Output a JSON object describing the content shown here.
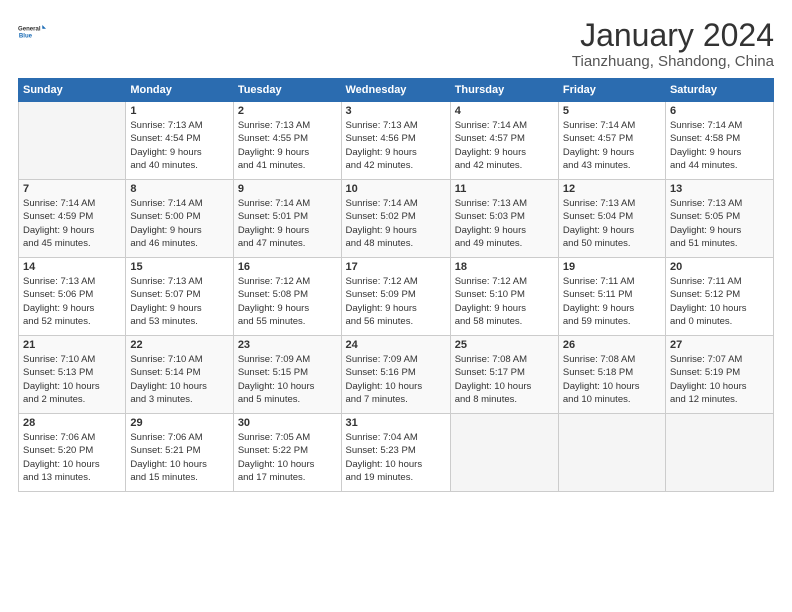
{
  "logo": {
    "line1": "General",
    "line2": "Blue"
  },
  "title": {
    "month_year": "January 2024",
    "location": "Tianzhuang, Shandong, China"
  },
  "weekdays": [
    "Sunday",
    "Monday",
    "Tuesday",
    "Wednesday",
    "Thursday",
    "Friday",
    "Saturday"
  ],
  "weeks": [
    [
      {
        "day": "",
        "info": ""
      },
      {
        "day": "1",
        "info": "Sunrise: 7:13 AM\nSunset: 4:54 PM\nDaylight: 9 hours\nand 40 minutes."
      },
      {
        "day": "2",
        "info": "Sunrise: 7:13 AM\nSunset: 4:55 PM\nDaylight: 9 hours\nand 41 minutes."
      },
      {
        "day": "3",
        "info": "Sunrise: 7:13 AM\nSunset: 4:56 PM\nDaylight: 9 hours\nand 42 minutes."
      },
      {
        "day": "4",
        "info": "Sunrise: 7:14 AM\nSunset: 4:57 PM\nDaylight: 9 hours\nand 42 minutes."
      },
      {
        "day": "5",
        "info": "Sunrise: 7:14 AM\nSunset: 4:57 PM\nDaylight: 9 hours\nand 43 minutes."
      },
      {
        "day": "6",
        "info": "Sunrise: 7:14 AM\nSunset: 4:58 PM\nDaylight: 9 hours\nand 44 minutes."
      }
    ],
    [
      {
        "day": "7",
        "info": "Sunrise: 7:14 AM\nSunset: 4:59 PM\nDaylight: 9 hours\nand 45 minutes."
      },
      {
        "day": "8",
        "info": "Sunrise: 7:14 AM\nSunset: 5:00 PM\nDaylight: 9 hours\nand 46 minutes."
      },
      {
        "day": "9",
        "info": "Sunrise: 7:14 AM\nSunset: 5:01 PM\nDaylight: 9 hours\nand 47 minutes."
      },
      {
        "day": "10",
        "info": "Sunrise: 7:14 AM\nSunset: 5:02 PM\nDaylight: 9 hours\nand 48 minutes."
      },
      {
        "day": "11",
        "info": "Sunrise: 7:13 AM\nSunset: 5:03 PM\nDaylight: 9 hours\nand 49 minutes."
      },
      {
        "day": "12",
        "info": "Sunrise: 7:13 AM\nSunset: 5:04 PM\nDaylight: 9 hours\nand 50 minutes."
      },
      {
        "day": "13",
        "info": "Sunrise: 7:13 AM\nSunset: 5:05 PM\nDaylight: 9 hours\nand 51 minutes."
      }
    ],
    [
      {
        "day": "14",
        "info": "Sunrise: 7:13 AM\nSunset: 5:06 PM\nDaylight: 9 hours\nand 52 minutes."
      },
      {
        "day": "15",
        "info": "Sunrise: 7:13 AM\nSunset: 5:07 PM\nDaylight: 9 hours\nand 53 minutes."
      },
      {
        "day": "16",
        "info": "Sunrise: 7:12 AM\nSunset: 5:08 PM\nDaylight: 9 hours\nand 55 minutes."
      },
      {
        "day": "17",
        "info": "Sunrise: 7:12 AM\nSunset: 5:09 PM\nDaylight: 9 hours\nand 56 minutes."
      },
      {
        "day": "18",
        "info": "Sunrise: 7:12 AM\nSunset: 5:10 PM\nDaylight: 9 hours\nand 58 minutes."
      },
      {
        "day": "19",
        "info": "Sunrise: 7:11 AM\nSunset: 5:11 PM\nDaylight: 9 hours\nand 59 minutes."
      },
      {
        "day": "20",
        "info": "Sunrise: 7:11 AM\nSunset: 5:12 PM\nDaylight: 10 hours\nand 0 minutes."
      }
    ],
    [
      {
        "day": "21",
        "info": "Sunrise: 7:10 AM\nSunset: 5:13 PM\nDaylight: 10 hours\nand 2 minutes."
      },
      {
        "day": "22",
        "info": "Sunrise: 7:10 AM\nSunset: 5:14 PM\nDaylight: 10 hours\nand 3 minutes."
      },
      {
        "day": "23",
        "info": "Sunrise: 7:09 AM\nSunset: 5:15 PM\nDaylight: 10 hours\nand 5 minutes."
      },
      {
        "day": "24",
        "info": "Sunrise: 7:09 AM\nSunset: 5:16 PM\nDaylight: 10 hours\nand 7 minutes."
      },
      {
        "day": "25",
        "info": "Sunrise: 7:08 AM\nSunset: 5:17 PM\nDaylight: 10 hours\nand 8 minutes."
      },
      {
        "day": "26",
        "info": "Sunrise: 7:08 AM\nSunset: 5:18 PM\nDaylight: 10 hours\nand 10 minutes."
      },
      {
        "day": "27",
        "info": "Sunrise: 7:07 AM\nSunset: 5:19 PM\nDaylight: 10 hours\nand 12 minutes."
      }
    ],
    [
      {
        "day": "28",
        "info": "Sunrise: 7:06 AM\nSunset: 5:20 PM\nDaylight: 10 hours\nand 13 minutes."
      },
      {
        "day": "29",
        "info": "Sunrise: 7:06 AM\nSunset: 5:21 PM\nDaylight: 10 hours\nand 15 minutes."
      },
      {
        "day": "30",
        "info": "Sunrise: 7:05 AM\nSunset: 5:22 PM\nDaylight: 10 hours\nand 17 minutes."
      },
      {
        "day": "31",
        "info": "Sunrise: 7:04 AM\nSunset: 5:23 PM\nDaylight: 10 hours\nand 19 minutes."
      },
      {
        "day": "",
        "info": ""
      },
      {
        "day": "",
        "info": ""
      },
      {
        "day": "",
        "info": ""
      }
    ]
  ]
}
